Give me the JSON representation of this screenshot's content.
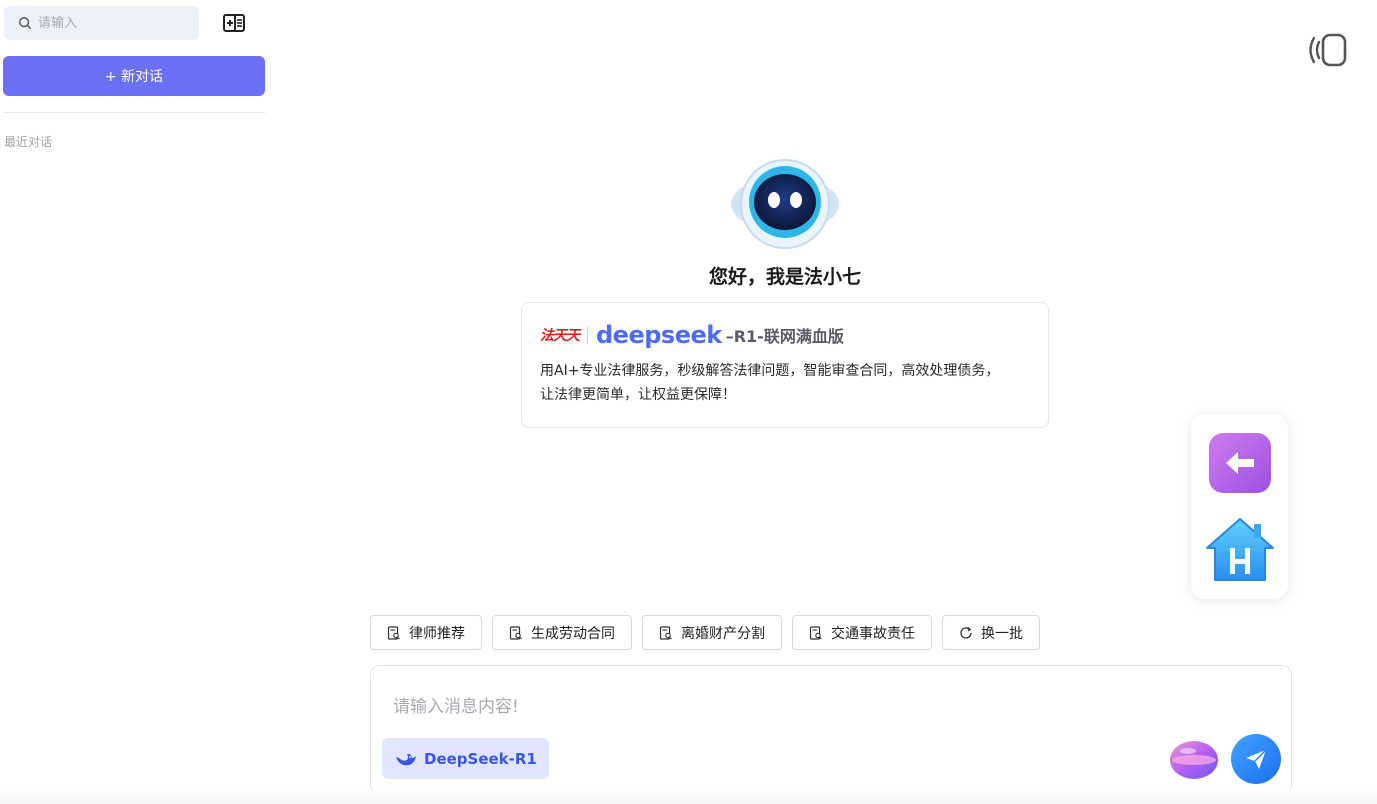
{
  "sidebar": {
    "search_placeholder": "请输入",
    "new_chat_label": "+ 新对话",
    "recent_label": "最近对话"
  },
  "hero": {
    "greeting": "您好，我是法小七",
    "brand_fatiantian": "法天天",
    "brand_deepseek": "deepseek",
    "brand_suffix": "–R1-联网满血版",
    "intro_line1": "用AI+专业法律服务，秒级解答法律问题，智能审查合同，高效处理债务，",
    "intro_line2": "让法律更简单，让权益更保障！"
  },
  "quick_prompts": [
    {
      "label": "律师推荐",
      "icon": "document-search-icon"
    },
    {
      "label": "生成劳动合同",
      "icon": "document-search-icon"
    },
    {
      "label": "离婚财产分割",
      "icon": "document-search-icon"
    },
    {
      "label": "交通事故责任",
      "icon": "document-search-icon"
    },
    {
      "label": "换一批",
      "icon": "refresh-icon"
    }
  ],
  "composer": {
    "placeholder": "请输入消息内容!",
    "model_label": "DeepSeek-R1"
  },
  "colors": {
    "primary": "#6b6ff5",
    "deepseek_blue": "#4d6bfe",
    "brand_red": "#d6201f",
    "send_blue": "#1e6ff0"
  }
}
